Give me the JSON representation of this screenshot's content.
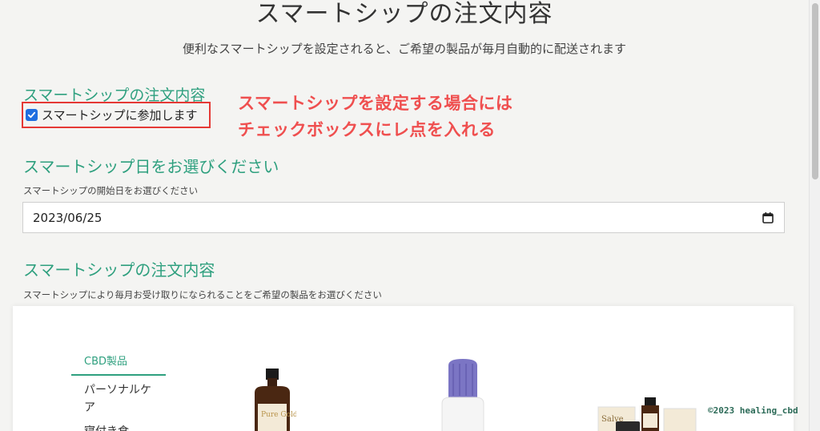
{
  "header": {
    "title": "スマートシップの注文内容",
    "subtitle": "便利なスマートシップを設定されると、ご希望の製品が毎月自動的に配送されます"
  },
  "optin_section": {
    "heading": "スマートシップの注文内容",
    "checkbox_label": "スマートシップに参加します",
    "checked": true
  },
  "annotation": {
    "line1": "スマートシップを設定する場合には",
    "line2": "チェックボックスにレ点を入れる",
    "color": "#ef4f4f"
  },
  "date_section": {
    "heading": "スマートシップ日をお選びください",
    "label": "スマートシップの開始日をお選びください",
    "value": "2023/06/25"
  },
  "order_section": {
    "heading": "スマートシップの注文内容",
    "description": "スマートシップにより毎月お受け取りになられることをご希望の製品をお選びください"
  },
  "categories": [
    {
      "label": "CBD製品",
      "active": true
    },
    {
      "label": "パーソナルケア",
      "active": false
    },
    {
      "label": "寝付き食",
      "active": false
    }
  ],
  "products": [
    {
      "icon": "amber-bottle-pure-gold",
      "brand_text": "Pure Gold"
    },
    {
      "icon": "dropper-bottle-purple-cap",
      "brand_text": ""
    },
    {
      "icon": "salve-pure-gold-set",
      "brand_text": "Salve"
    }
  ],
  "watermark": "©2023 healing_cbd",
  "colors": {
    "accent": "#2fa07f",
    "checkbox": "#1f6fe0",
    "highlight_border": "#e53935"
  }
}
